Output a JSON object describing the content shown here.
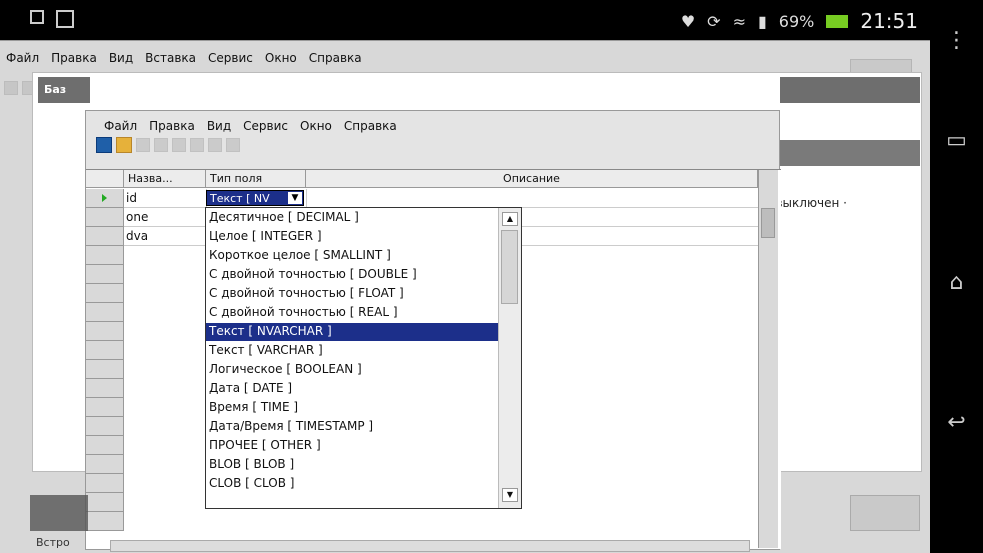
{
  "status_bar": {
    "battery": "69%",
    "time": "21:51"
  },
  "main_menu": [
    "Файл",
    "Правка",
    "Вид",
    "Вставка",
    "Сервис",
    "Окно",
    "Справка"
  ],
  "doc_header": "Баз",
  "table_menu": [
    "Файл",
    "Правка",
    "Вид",
    "Сервис",
    "Окно",
    "Справка"
  ],
  "grid": {
    "headers": [
      "Назва...",
      "Тип поля",
      "Описание"
    ],
    "rows": [
      {
        "name": "id"
      },
      {
        "name": "one"
      },
      {
        "name": "dva"
      }
    ],
    "selected_type": "Текст [ NV"
  },
  "type_list": {
    "items": [
      "Десятичное [ DECIMAL ]",
      "Целое [ INTEGER ]",
      "Короткое целое [ SMALLINT ]",
      "С двойной точностью [ DOUBLE ]",
      "С двойной точностью [ FLOAT ]",
      "С двойной точностью [ REAL ]",
      "Текст [ NVARCHAR ]",
      "Текст [ VARCHAR ]",
      "Логическое [ BOOLEAN ]",
      "Дата [ DATE ]",
      "Время [ TIME ]",
      "Дата/Время [ TIMESTAMP ]",
      "ПРОЧЕЕ [ OTHER ]",
      "BLOB [ BLOB ]",
      "CLOB [ CLOB ]"
    ],
    "selected_index": 6
  },
  "filter_label": "р: выключен ·",
  "bottom_label": "Встро"
}
